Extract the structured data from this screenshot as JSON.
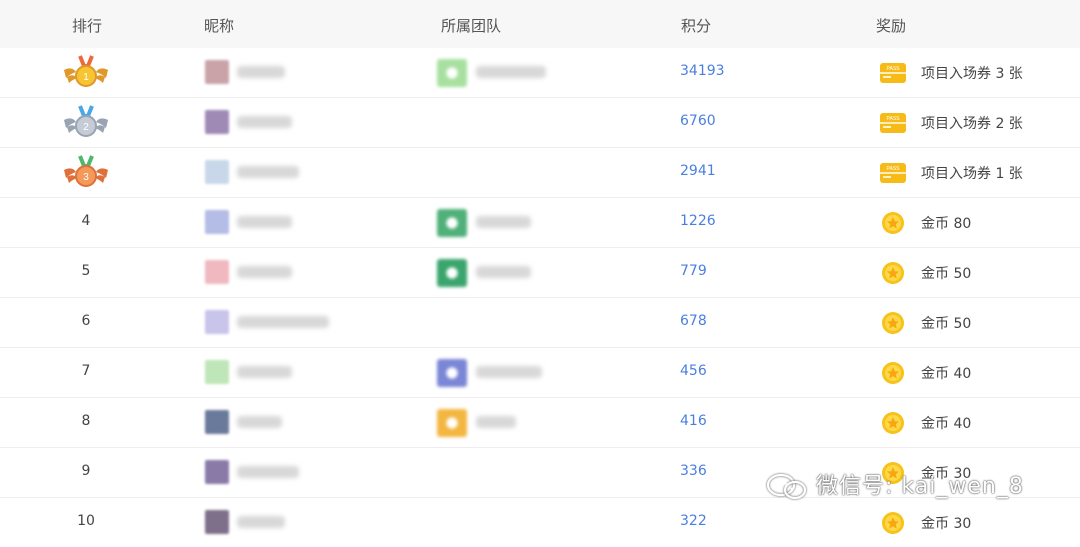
{
  "header": {
    "rank": "排行",
    "nickname": "昵称",
    "team": "所属团队",
    "score": "积分",
    "reward": "奖励"
  },
  "rows": [
    {
      "rank": "1",
      "medal": "gold",
      "avatar_color": "#c9a3a8",
      "name_w": 48,
      "team": true,
      "team_color": "#a8e0a0",
      "team_w": 70,
      "score": "34193",
      "reward_type": "ticket",
      "reward": "项目入场券 3 张"
    },
    {
      "rank": "2",
      "medal": "silver",
      "avatar_color": "#9f8ab5",
      "name_w": 55,
      "team": false,
      "score": "6760",
      "reward_type": "ticket",
      "reward": "项目入场券 2 张"
    },
    {
      "rank": "3",
      "medal": "bronze",
      "avatar_color": "#c8d8ea",
      "name_w": 62,
      "team": false,
      "score": "2941",
      "reward_type": "ticket",
      "reward": "项目入场券 1 张"
    },
    {
      "rank": "4",
      "medal": "",
      "avatar_color": "#b3bde6",
      "name_w": 55,
      "team": true,
      "team_color": "#4fb079",
      "team_w": 55,
      "score": "1226",
      "reward_type": "coin",
      "reward": "金币 80"
    },
    {
      "rank": "5",
      "medal": "",
      "avatar_color": "#f0b9c0",
      "name_w": 55,
      "team": true,
      "team_color": "#3aa56d",
      "team_w": 55,
      "score": "779",
      "reward_type": "coin",
      "reward": "金币 50"
    },
    {
      "rank": "6",
      "medal": "",
      "avatar_color": "#c8c4ea",
      "name_w": 92,
      "team": false,
      "score": "678",
      "reward_type": "coin",
      "reward": "金币 50"
    },
    {
      "rank": "7",
      "medal": "",
      "avatar_color": "#bfe6b8",
      "name_w": 55,
      "team": true,
      "team_color": "#7a86d6",
      "team_w": 66,
      "score": "456",
      "reward_type": "coin",
      "reward": "金币 40"
    },
    {
      "rank": "8",
      "medal": "",
      "avatar_color": "#6a7a9a",
      "name_w": 45,
      "team": true,
      "team_color": "#f3b640",
      "team_w": 40,
      "score": "416",
      "reward_type": "coin",
      "reward": "金币 40"
    },
    {
      "rank": "9",
      "medal": "",
      "avatar_color": "#8a7aa8",
      "name_w": 62,
      "team": false,
      "score": "336",
      "reward_type": "coin",
      "reward": "金币 30"
    },
    {
      "rank": "10",
      "medal": "",
      "avatar_color": "#7e6f8a",
      "name_w": 48,
      "team": false,
      "score": "322",
      "reward_type": "coin",
      "reward": "金币 30"
    }
  ],
  "watermark": "微信号: kai_wen_8",
  "colors": {
    "score": "#4a7fe0",
    "gold": "#f5b81b",
    "silver": "#b5bcc8",
    "bronze": "#ee8a4a"
  }
}
